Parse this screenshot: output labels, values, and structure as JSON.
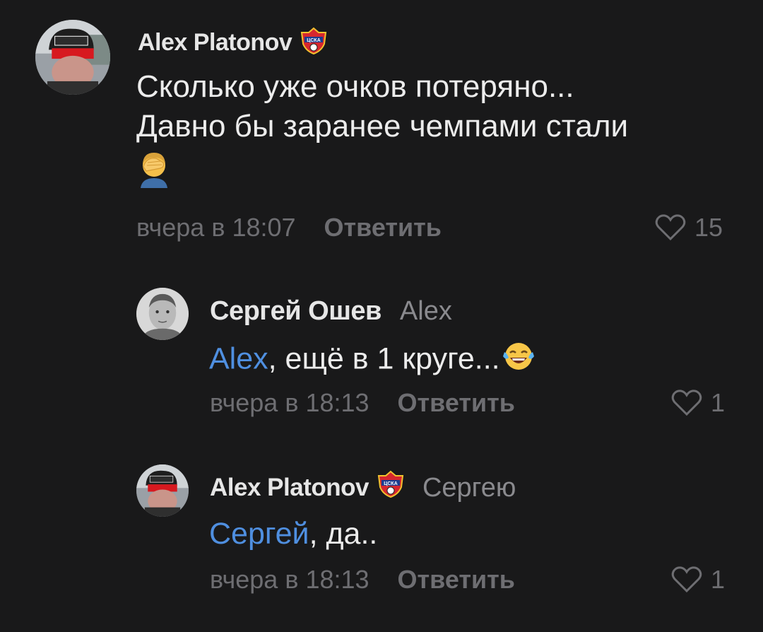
{
  "comments": [
    {
      "author": "Alex Platonov",
      "badge": "ЦСКА",
      "text_line1": "Сколько уже очков потеряно...",
      "text_line2": "Давно бы заранее чемпами стали",
      "emoji": "facepalm-emoji",
      "time": "вчера в 18:07",
      "reply_label": "Ответить",
      "likes": "15"
    },
    {
      "author": "Сергей Ошев",
      "reply_to": "Alex",
      "mention": "Alex",
      "text": ", ещё в 1 круге...",
      "emoji": "tears-of-joy-emoji",
      "time": "вчера в 18:13",
      "reply_label": "Ответить",
      "likes": "1"
    },
    {
      "author": "Alex Platonov",
      "badge": "ЦСКА",
      "reply_to": "Сергею",
      "mention": "Сергей",
      "text": ", да..",
      "time": "вчера в 18:13",
      "reply_label": "Ответить",
      "likes": "1"
    }
  ],
  "colors": {
    "background": "#19191a",
    "author": "#e6e6e6",
    "text": "#ececec",
    "meta": "#6e6e72",
    "mention": "#4f8fe0"
  }
}
